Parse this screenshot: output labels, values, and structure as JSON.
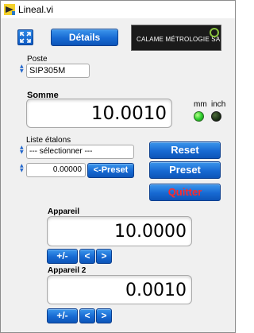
{
  "window": {
    "title": "Lineal.vi"
  },
  "header": {
    "details_label": "Détails",
    "logo_text": "CALAME MÉTROLOGIE SA"
  },
  "poste": {
    "label": "Poste",
    "value": "SIP305M"
  },
  "somme": {
    "label": "Somme",
    "value": "10.0010"
  },
  "units": {
    "mm_label": "mm",
    "inch_label": "inch",
    "mm_active": true,
    "inch_active": false
  },
  "etalons": {
    "label": "Liste étalons",
    "selected": "--- sélectionner ---",
    "preset_value": "0.00000",
    "preset_button": "<-Preset"
  },
  "actions": {
    "reset": "Reset",
    "preset": "Preset",
    "quit": "Quitter"
  },
  "appareil": {
    "label": "Appareil",
    "value": "10.0000",
    "plus_minus": "+/-",
    "left": "<",
    "right": ">"
  },
  "appareil2": {
    "label": "Appareil 2",
    "value": "0.0010",
    "plus_minus": "+/-",
    "left": "<",
    "right": ">"
  },
  "colors": {
    "button_blue": "#1769d2",
    "quit_text": "#ff2a2a",
    "led_on": "#2fd02f",
    "led_off": "#1b3015"
  }
}
